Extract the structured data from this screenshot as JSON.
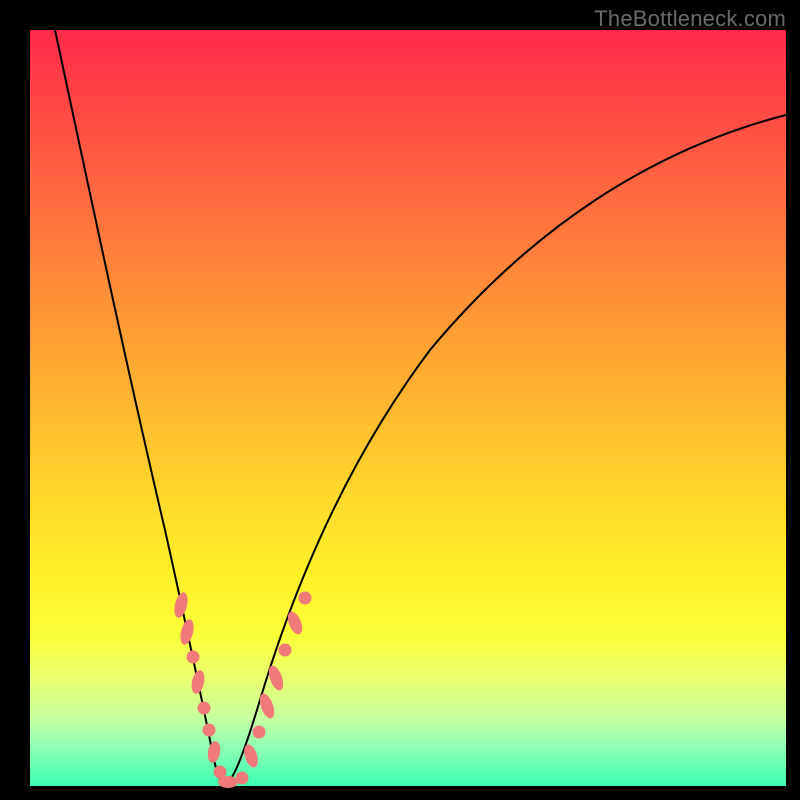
{
  "watermark": "TheBottleneck.com",
  "colors": {
    "background_frame": "#000000",
    "curve": "#000000",
    "beads": "#f07a7a",
    "gradient_top": "#ff2a4a",
    "gradient_bottom": "#3affb3"
  },
  "chart_data": {
    "type": "line",
    "title": "",
    "xlabel": "",
    "ylabel": "",
    "xlim": [
      0,
      100
    ],
    "ylim": [
      0,
      100
    ],
    "grid": false,
    "series": [
      {
        "name": "left-branch",
        "x": [
          3,
          5,
          8,
          11,
          13,
          15,
          17,
          18.5,
          20,
          21,
          22,
          23,
          24,
          25
        ],
        "y": [
          100,
          88,
          72,
          58,
          48,
          39,
          30,
          23,
          16,
          11,
          7,
          4,
          1.5,
          0
        ]
      },
      {
        "name": "right-branch",
        "x": [
          25,
          26,
          27,
          28,
          30,
          33,
          37,
          42,
          49,
          57,
          66,
          76,
          86,
          96,
          100
        ],
        "y": [
          0,
          1.5,
          4,
          8,
          15,
          25,
          36,
          46,
          56,
          65,
          72,
          78,
          83,
          87,
          89
        ]
      }
    ],
    "highlight_points": {
      "name": "beads",
      "points": [
        {
          "x": 19.5,
          "y": 20
        },
        {
          "x": 20.5,
          "y": 15
        },
        {
          "x": 21.5,
          "y": 11
        },
        {
          "x": 22.3,
          "y": 7
        },
        {
          "x": 23.0,
          "y": 4
        },
        {
          "x": 24.0,
          "y": 2
        },
        {
          "x": 25.0,
          "y": 0.5
        },
        {
          "x": 26.0,
          "y": 1
        },
        {
          "x": 27.0,
          "y": 3
        },
        {
          "x": 28.0,
          "y": 7
        },
        {
          "x": 29.5,
          "y": 13
        },
        {
          "x": 31.0,
          "y": 19
        },
        {
          "x": 32.5,
          "y": 24
        }
      ]
    }
  }
}
